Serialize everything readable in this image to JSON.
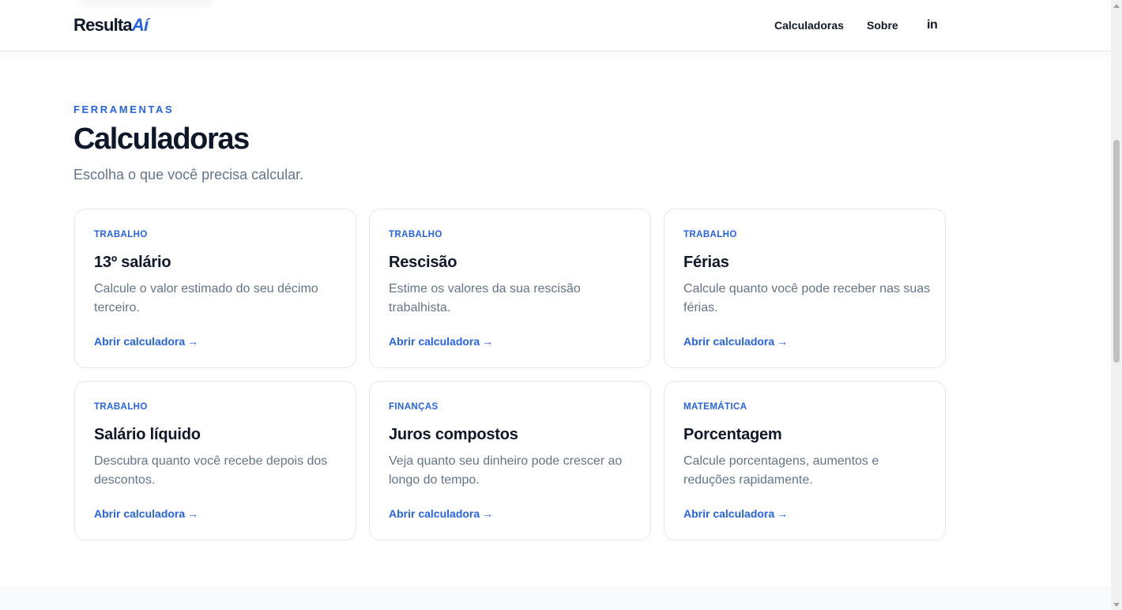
{
  "header": {
    "logo_main": "Resulta",
    "logo_accent": "Aí",
    "nav": [
      "Calculadoras",
      "Sobre"
    ],
    "linkedin_label": "in"
  },
  "hero": {
    "eyebrow": "FERRAMENTAS",
    "title": "Calculadoras",
    "subtitle": "Escolha o que você precisa calcular."
  },
  "cards": [
    {
      "category": "TRABALHO",
      "title": "13º salário",
      "description": "Calcule o valor estimado do seu décimo terceiro.",
      "link": "Abrir calculadora",
      "arrow": "→"
    },
    {
      "category": "TRABALHO",
      "title": "Rescisão",
      "description": "Estime os valores da sua rescisão trabalhista.",
      "link": "Abrir calculadora",
      "arrow": "→"
    },
    {
      "category": "TRABALHO",
      "title": "Férias",
      "description": "Calcule quanto você pode receber nas suas férias.",
      "link": "Abrir calculadora",
      "arrow": "→"
    },
    {
      "category": "TRABALHO",
      "title": "Salário líquido",
      "description": "Descubra quanto você recebe depois dos descontos.",
      "link": "Abrir calculadora",
      "arrow": "→"
    },
    {
      "category": "FINANÇAS",
      "title": "Juros compostos",
      "description": "Veja quanto seu dinheiro pode crescer ao longo do tempo.",
      "link": "Abrir calculadora",
      "arrow": "→"
    },
    {
      "category": "MATEMÁTICA",
      "title": "Porcentagem",
      "description": "Calcule porcentagens, aumentos e reduções rapidamente.",
      "link": "Abrir calculadora",
      "arrow": "→"
    }
  ],
  "colors": {
    "accent": "#2563eb",
    "heading": "#0f172a",
    "muted": "#64748b",
    "border": "#e5e7eb"
  },
  "icons": {
    "linkedin": "linkedin-icon",
    "arrow": "arrow-right-icon"
  }
}
